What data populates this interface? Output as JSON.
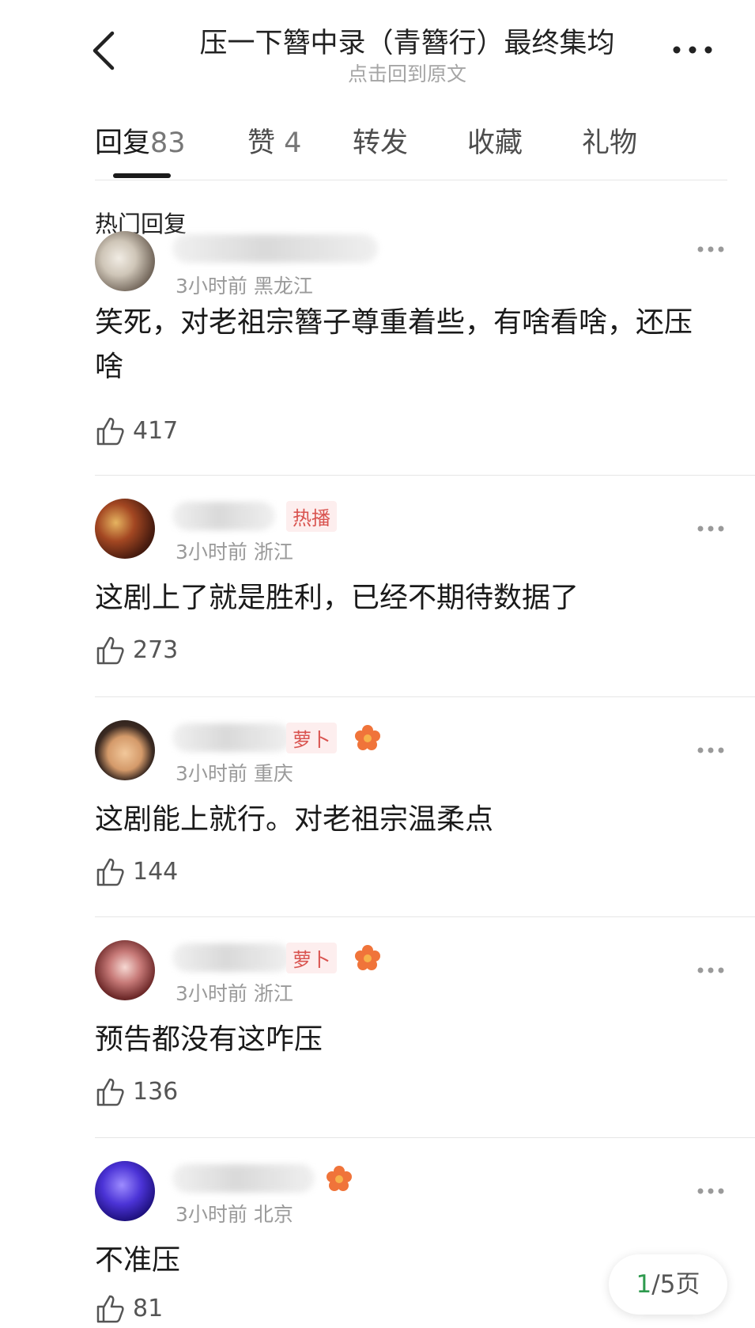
{
  "header": {
    "title": "压一下簪中录（青簪行）最终集均",
    "subtitle": "点击回到原文"
  },
  "tabs": [
    {
      "label": "回复",
      "count": "83"
    },
    {
      "label": "赞",
      "count": "4"
    },
    {
      "label": "转发"
    },
    {
      "label": "收藏"
    },
    {
      "label": "礼物"
    }
  ],
  "section_title": "热门回复",
  "comments": [
    {
      "time": "3小时前",
      "location": "黑龙江",
      "text": "笑死，对老祖宗簪子尊重着些，有啥看啥，还压啥",
      "likes": "417"
    },
    {
      "time": "3小时前",
      "location": "浙江",
      "badge": "热播",
      "text": "这剧上了就是胜利，已经不期待数据了",
      "likes": "273"
    },
    {
      "time": "3小时前",
      "location": "重庆",
      "badge": "萝卜",
      "text": "这剧能上就行。对老祖宗温柔点",
      "likes": "144"
    },
    {
      "time": "3小时前",
      "location": "浙江",
      "badge": "萝卜",
      "text": "预告都没有这咋压",
      "likes": "136"
    },
    {
      "time": "3小时前",
      "location": "北京",
      "text": "不准压",
      "likes": "81"
    }
  ],
  "pager": {
    "current": "1",
    "total_label": "/5页"
  },
  "colors": {
    "badge_red": "#d9534f",
    "pager_green": "#2e9a4e"
  }
}
